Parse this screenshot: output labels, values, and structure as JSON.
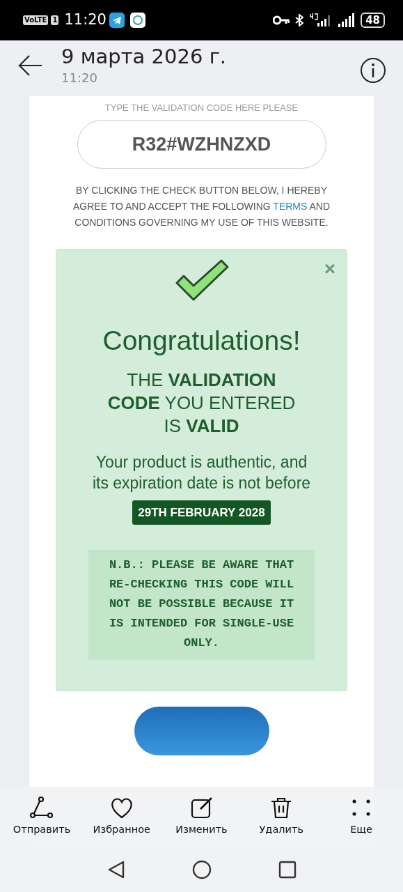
{
  "status_bar": {
    "network_badge": "VoLTE",
    "sim": "1",
    "time": "11:20",
    "battery": "48"
  },
  "viewer_header": {
    "date": "9 марта 2026 г.",
    "time": "11:20"
  },
  "page": {
    "hint": "TYPE THE VALIDATION CODE HERE PLEASE",
    "code_field": {
      "value": "R32#WZHNZXD"
    },
    "agreement": {
      "before": "BY CLICKING THE CHECK BUTTON BELOW, I HEREBY AGREE TO AND ACCEPT THE FOLLOWING",
      "link": "TERMS",
      "after": "AND CONDITIONS GOVERNING MY USE OF THIS WEBSITE."
    },
    "alert": {
      "close": "×",
      "title": "Congratulations!",
      "message": "THE **VALIDATION CODE** YOU ENTERED IS **VALID**",
      "detail": "Your product is authentic, and its expiration date is not before",
      "date_badge": "29TH FEBRUARY 2028",
      "note": "N.B.: PLEASE BE AWARE THAT RE-CHECKING THIS CODE WILL NOT BE POSSIBLE BECAUSE IT IS INTENDED FOR SINGLE-USE ONLY."
    }
  },
  "toolbar": [
    {
      "kind": "share",
      "label": "Отправить"
    },
    {
      "kind": "favorite",
      "label": "Избранное"
    },
    {
      "kind": "edit",
      "label": "Изменить"
    },
    {
      "kind": "delete",
      "label": "Удалить"
    },
    {
      "kind": "more",
      "label": "Еще"
    }
  ]
}
